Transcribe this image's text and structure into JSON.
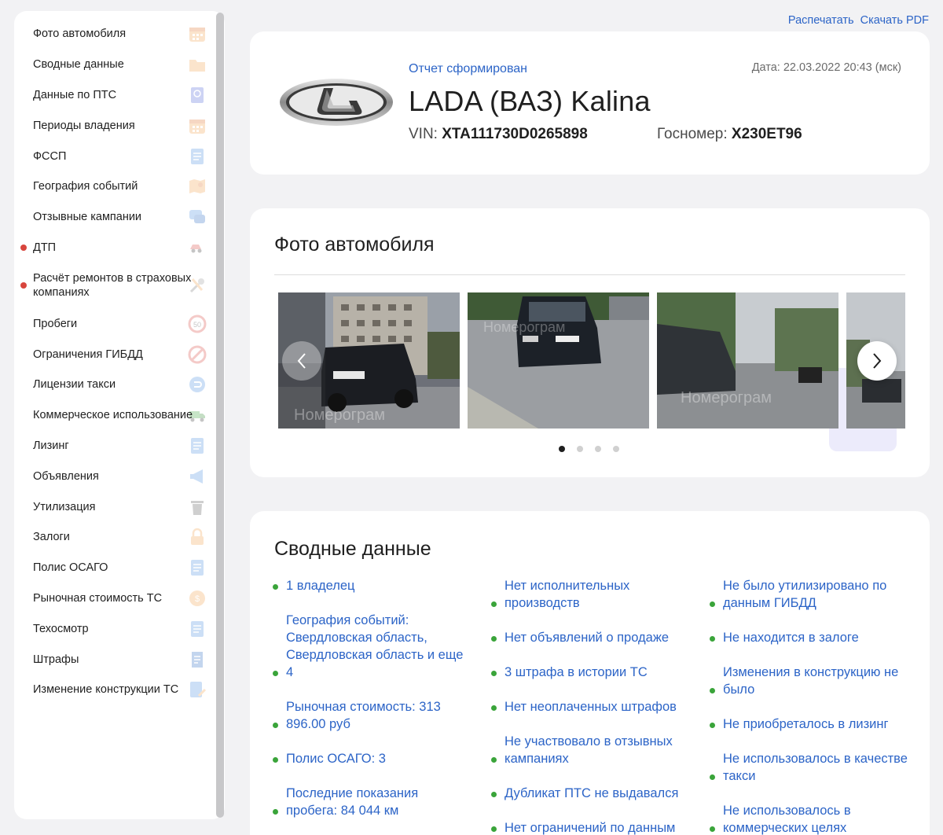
{
  "top_links": {
    "print": "Распечатать",
    "download": "Скачать PDF"
  },
  "sidebar": {
    "items": [
      {
        "label": "Фото автомобиля",
        "icon": "calendar-icon",
        "alert": false
      },
      {
        "label": "Сводные данные",
        "icon": "folder-icon",
        "alert": false
      },
      {
        "label": "Данные по ПТС",
        "icon": "passport-icon",
        "alert": false
      },
      {
        "label": "Периоды владения",
        "icon": "calendar-icon",
        "alert": false
      },
      {
        "label": "ФССП",
        "icon": "document-icon",
        "alert": false
      },
      {
        "label": "География событий",
        "icon": "map-icon",
        "alert": false
      },
      {
        "label": "Отзывные кампании",
        "icon": "chat-icon",
        "alert": false
      },
      {
        "label": "ДТП",
        "icon": "crash-icon",
        "alert": true
      },
      {
        "label": "Расчёт ремонтов в страховых компаниях",
        "icon": "tools-icon",
        "alert": true
      },
      {
        "label": "Пробеги",
        "icon": "speed-sign-icon",
        "alert": false
      },
      {
        "label": "Ограничения ГИБДД",
        "icon": "prohibited-icon",
        "alert": false
      },
      {
        "label": "Лицензии такси",
        "icon": "taxi-icon",
        "alert": false
      },
      {
        "label": "Коммерческое использование",
        "icon": "truck-icon",
        "alert": false
      },
      {
        "label": "Лизинг",
        "icon": "document-icon",
        "alert": false
      },
      {
        "label": "Объявления",
        "icon": "megaphone-icon",
        "alert": false
      },
      {
        "label": "Утилизация",
        "icon": "trash-icon",
        "alert": false
      },
      {
        "label": "Залоги",
        "icon": "lock-icon",
        "alert": false
      },
      {
        "label": "Полис ОСАГО",
        "icon": "document-icon",
        "alert": false
      },
      {
        "label": "Рыночная стоимость ТС",
        "icon": "coin-icon",
        "alert": false
      },
      {
        "label": "Техосмотр",
        "icon": "document-icon",
        "alert": false
      },
      {
        "label": "Штрафы",
        "icon": "receipt-icon",
        "alert": false
      },
      {
        "label": "Изменение конструкции ТС",
        "icon": "edit-document-icon",
        "alert": false
      }
    ]
  },
  "header": {
    "status": "Отчет сформирован",
    "date": "Дата: 22.03.2022 20:43 (мск)",
    "title": "LADA (ВАЗ) Kalina",
    "vin_label": "VIN:",
    "vin": "XTA111730D0265898",
    "plate_label": "Госномер:",
    "plate": "X230ET96"
  },
  "photos": {
    "title": "Фото автомобиля",
    "watermark": "Номерограм",
    "count": 4,
    "active_index": 0
  },
  "summary": {
    "title": "Сводные данные",
    "col1": [
      "1 владелец",
      "География событий: Свердловская область, Свердловская область и еще 4",
      "Рыночная стоимость: 313 896.00 руб",
      "Полис ОСАГО: 3",
      "Последние показания пробега: 84 044 км"
    ],
    "col2": [
      "Нет исполнительных производств",
      "Нет объявлений о продаже",
      "3 штрафа в истории ТС",
      "Нет неоплаченных штрафов",
      "Не участвовало в отзывных кампаниях",
      "Дубликат ПТС не выдавался",
      "Нет ограничений по данным"
    ],
    "col3": [
      "Не было утилизировано по данным ГИБДД",
      "Не находится в залоге",
      "Изменения в конструкцию не было",
      "Не приобреталось в лизинг",
      "Не использовалось в качестве такси",
      "Не использовалось в коммерческих целях"
    ]
  },
  "colors": {
    "accent": "#2c64c7",
    "alert": "#d8453d",
    "ok": "#3aa43a",
    "background": "#f2f2f4"
  }
}
